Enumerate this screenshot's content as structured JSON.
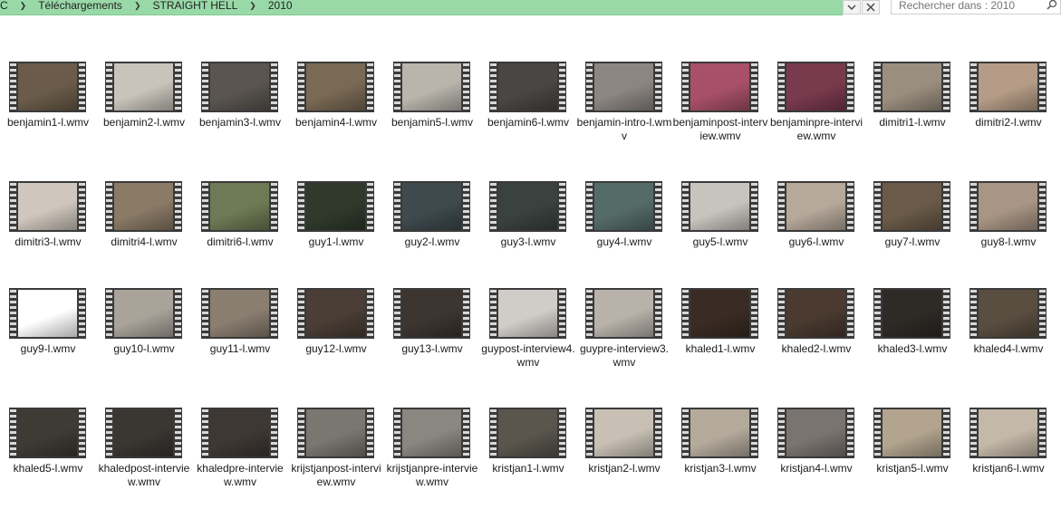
{
  "breadcrumb": [
    "C",
    "Téléchargements",
    "STRAIGHT HELL",
    "2010"
  ],
  "address_bar": {
    "dropdown_icon": "chevron-down-icon",
    "close_icon": "close-icon"
  },
  "search": {
    "placeholder": "Rechercher dans : 2010",
    "icon": "search-icon"
  },
  "colors": {
    "address_bar_bg": "#99d9a8",
    "film_strip": "#3a3a3a"
  },
  "files": [
    {
      "name": "benjamin1-l.wmv",
      "bg": "#6b5c4a"
    },
    {
      "name": "benjamin2-l.wmv",
      "bg": "#c9c4bb"
    },
    {
      "name": "benjamin3-l.wmv",
      "bg": "#5a5550"
    },
    {
      "name": "benjamin4-l.wmv",
      "bg": "#7a6a55"
    },
    {
      "name": "benjamin5-l.wmv",
      "bg": "#b9b5ad"
    },
    {
      "name": "benjamin6-l.wmv",
      "bg": "#4a4644"
    },
    {
      "name": "benjamin-intro-l.wmv",
      "bg": "#8c8682"
    },
    {
      "name": "benjaminpost-interview.wmv",
      "bg": "#a8506a"
    },
    {
      "name": "benjaminpre-interview.wmv",
      "bg": "#7a3a4e"
    },
    {
      "name": "dimitri1-l.wmv",
      "bg": "#9a8e7e"
    },
    {
      "name": "dimitri2-l.wmv",
      "bg": "#b59c86"
    },
    {
      "name": "dimitri3-l.wmv",
      "bg": "#cfc7bd"
    },
    {
      "name": "dimitri4-l.wmv",
      "bg": "#8a7a66"
    },
    {
      "name": "dimitri6-l.wmv",
      "bg": "#6e7a55"
    },
    {
      "name": "guy1-l.wmv",
      "bg": "#2f3a2c"
    },
    {
      "name": "guy2-l.wmv",
      "bg": "#3e4a4e"
    },
    {
      "name": "guy3-l.wmv",
      "bg": "#3a4240"
    },
    {
      "name": "guy4-l.wmv",
      "bg": "#556b68"
    },
    {
      "name": "guy5-l.wmv",
      "bg": "#c7c3bd"
    },
    {
      "name": "guy6-l.wmv",
      "bg": "#b6a89a"
    },
    {
      "name": "guy7-l.wmv",
      "bg": "#6a5a48"
    },
    {
      "name": "guy8-l.wmv",
      "bg": "#a89584"
    },
    {
      "name": "guy9-l.wmv",
      "bg": "#ffffff"
    },
    {
      "name": "guy10-l.wmv",
      "bg": "#a9a39a"
    },
    {
      "name": "guy11-l.wmv",
      "bg": "#8a7e70"
    },
    {
      "name": "guy12-l.wmv",
      "bg": "#4a3e36"
    },
    {
      "name": "guy13-l.wmv",
      "bg": "#3d3530"
    },
    {
      "name": "guypost-interview4.wmv",
      "bg": "#d0cdc8"
    },
    {
      "name": "guypre-interview3.wmv",
      "bg": "#b8b2aa"
    },
    {
      "name": "khaled1-l.wmv",
      "bg": "#3a2c24"
    },
    {
      "name": "khaled2-l.wmv",
      "bg": "#4a3a30"
    },
    {
      "name": "khaled3-l.wmv",
      "bg": "#2e2a26"
    },
    {
      "name": "khaled4-l.wmv",
      "bg": "#5a4e40"
    },
    {
      "name": "khaled5-l.wmv",
      "bg": "#3e3a34"
    },
    {
      "name": "khaledpost-interview.wmv",
      "bg": "#3a3632"
    },
    {
      "name": "khaledpre-interview.wmv",
      "bg": "#3e3834"
    },
    {
      "name": "krijstjanpost-interview.wmv",
      "bg": "#7a7670"
    },
    {
      "name": "krijstjanpre-interview.wmv",
      "bg": "#8a8680"
    },
    {
      "name": "kristjan1-l.wmv",
      "bg": "#5a564e"
    },
    {
      "name": "kristjan2-l.wmv",
      "bg": "#c8c0b4"
    },
    {
      "name": "kristjan3-l.wmv",
      "bg": "#b4aa9c"
    },
    {
      "name": "kristjan4-l.wmv",
      "bg": "#7a7470"
    },
    {
      "name": "kristjan5-l.wmv",
      "bg": "#b2a48e"
    },
    {
      "name": "kristjan6-l.wmv",
      "bg": "#c4b8a8"
    }
  ]
}
